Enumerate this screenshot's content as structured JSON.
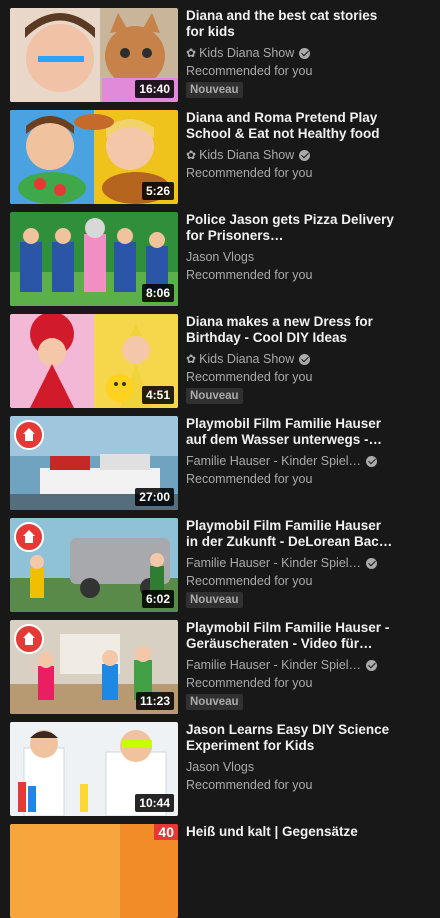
{
  "videos": [
    {
      "title": "Diana and the best cat stories for kids",
      "channel": "Kids Diana Show",
      "channel_icon": "flower-icon",
      "verified": true,
      "recommendation": "Recommended for you",
      "badge": "Nouveau",
      "duration": "16:40"
    },
    {
      "title": "Diana and Roma Pretend Play School & Eat not Healthy food",
      "channel": "Kids Diana Show",
      "channel_icon": "flower-icon",
      "verified": true,
      "recommendation": "Recommended for you",
      "badge": "",
      "duration": "5:26"
    },
    {
      "title": "Police Jason gets Pizza Delivery for Prisoners…",
      "channel": "Jason Vlogs",
      "verified": false,
      "recommendation": "Recommended for you",
      "badge": "",
      "duration": "8:06"
    },
    {
      "title": "Diana makes a new Dress for Birthday - Cool DIY Ideas",
      "channel": "Kids Diana Show",
      "channel_icon": "flower-icon",
      "verified": true,
      "recommendation": "Recommended for you",
      "badge": "Nouveau",
      "duration": "4:51"
    },
    {
      "title": "Playmobil Film Familie Hauser auf dem Wasser unterwegs -…",
      "channel": "Familie Hauser - Kinder Spiel…",
      "verified": true,
      "recommendation": "Recommended for you",
      "badge": "",
      "duration": "27:00"
    },
    {
      "title": "Playmobil Film Familie Hauser in der Zukunft - DeLorean Bac…",
      "channel": "Familie Hauser - Kinder Spiel…",
      "verified": true,
      "recommendation": "Recommended for you",
      "badge": "Nouveau",
      "duration": "6:02"
    },
    {
      "title": "Playmobil Film Familie Hauser - Geräuscheraten - Video für…",
      "channel": "Familie Hauser - Kinder Spiel…",
      "verified": true,
      "recommendation": "Recommended for you",
      "badge": "Nouveau",
      "duration": "11:23"
    },
    {
      "title": "Jason Learns Easy DIY Science Experiment for Kids",
      "channel": "Jason Vlogs",
      "verified": false,
      "recommendation": "Recommended for you",
      "badge": "",
      "duration": "10:44"
    },
    {
      "title": "Heiß und kalt | Gegensätze",
      "channel": "",
      "verified": false,
      "recommendation": "",
      "badge": "",
      "duration": "",
      "thumb_badge": "40"
    }
  ],
  "colors": {
    "background": "#181818",
    "title": "#f1f1f1",
    "secondary": "#aaaaaa",
    "badge_bg": "#303030"
  }
}
